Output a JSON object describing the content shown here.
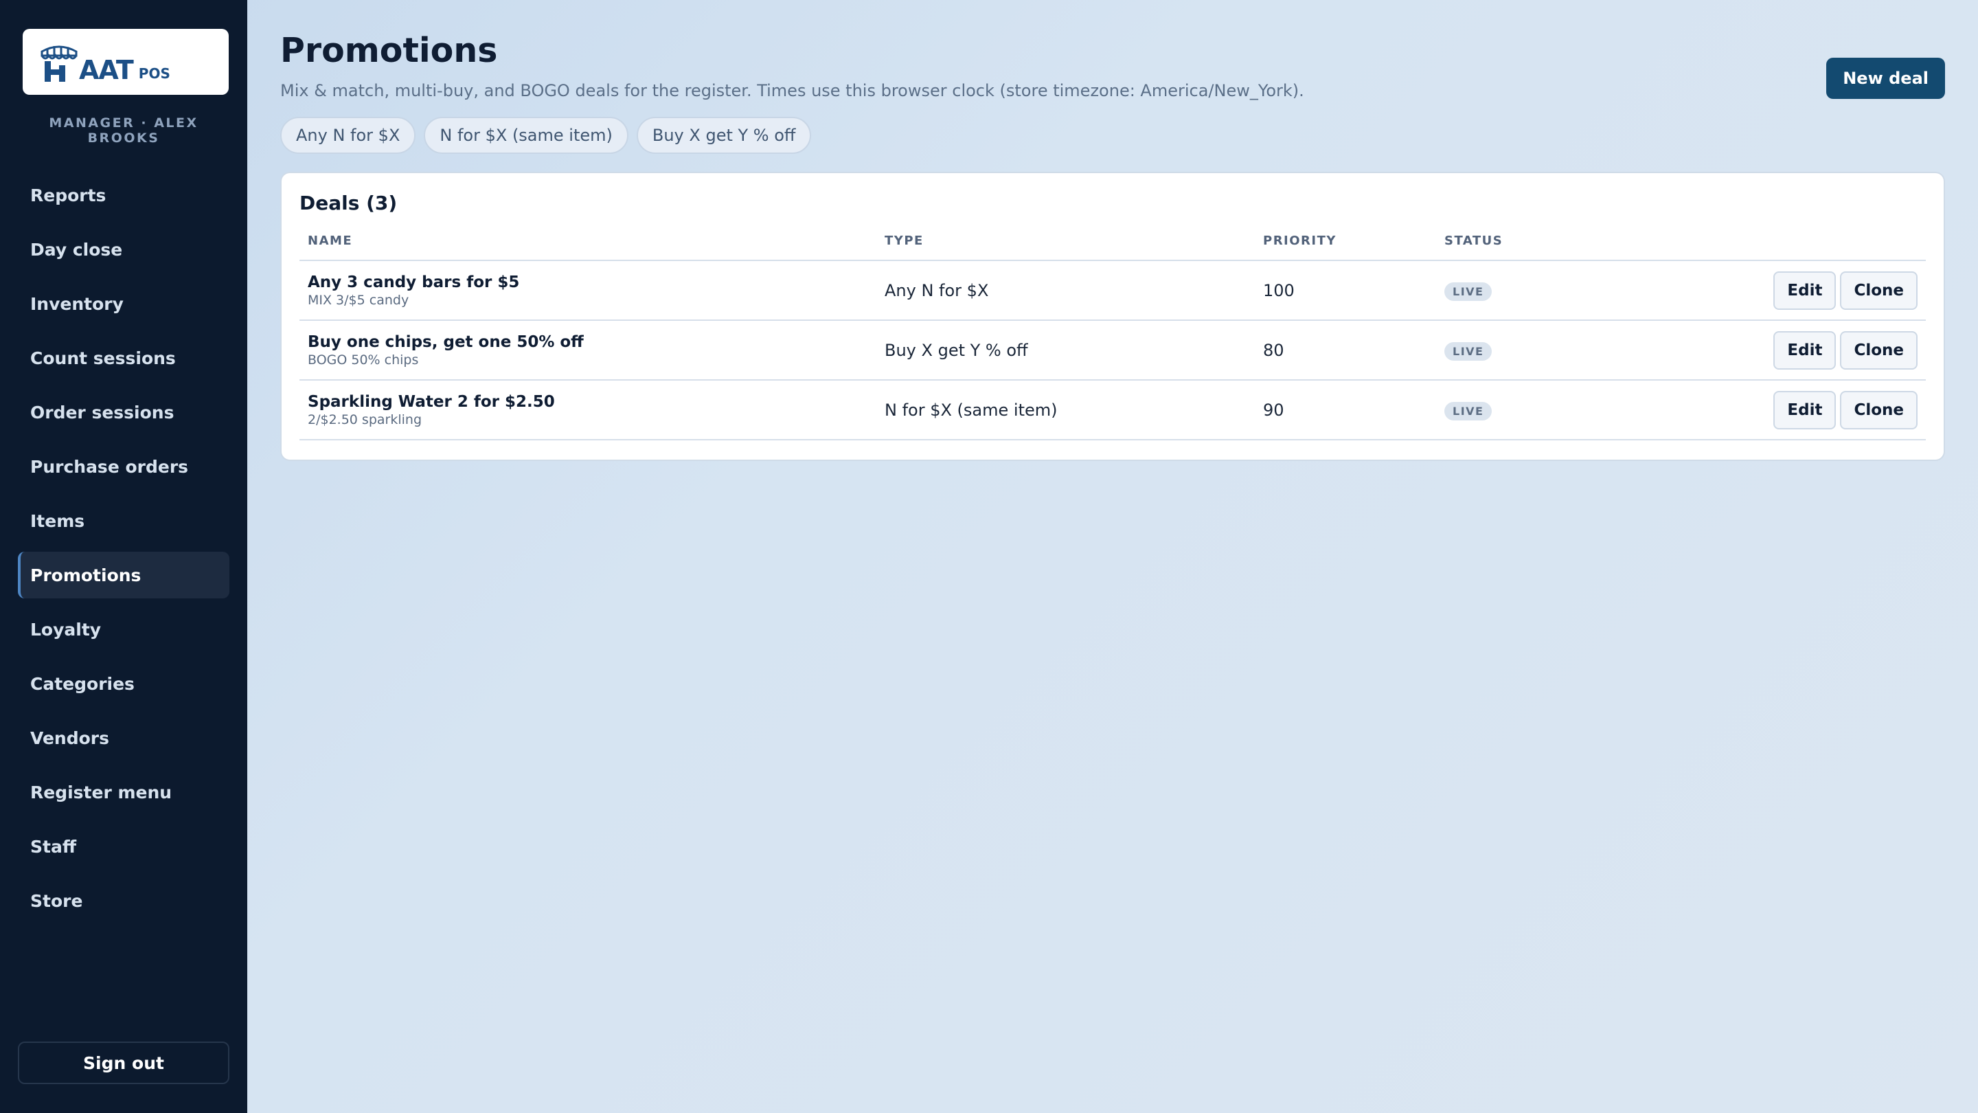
{
  "logo": {
    "text": "AAT",
    "sub": "POS"
  },
  "role_line": "MANAGER · ALEX BROOKS",
  "sidebar": {
    "items": [
      {
        "label": "Reports"
      },
      {
        "label": "Day close"
      },
      {
        "label": "Inventory"
      },
      {
        "label": "Count sessions"
      },
      {
        "label": "Order sessions"
      },
      {
        "label": "Purchase orders"
      },
      {
        "label": "Items"
      },
      {
        "label": "Promotions",
        "active": true
      },
      {
        "label": "Loyalty"
      },
      {
        "label": "Categories"
      },
      {
        "label": "Vendors"
      },
      {
        "label": "Register menu"
      },
      {
        "label": "Staff"
      },
      {
        "label": "Store"
      }
    ],
    "sign_out": "Sign out"
  },
  "header": {
    "title": "Promotions",
    "subtitle": "Mix & match, multi-buy, and BOGO deals for the register. Times use this browser clock (store timezone: America/New_York).",
    "new_deal": "New deal"
  },
  "chips": [
    "Any N for $X",
    "N for $X (same item)",
    "Buy X get Y % off"
  ],
  "deals": {
    "title": "Deals (3)",
    "columns": [
      "NAME",
      "TYPE",
      "PRIORITY",
      "STATUS"
    ],
    "rows": [
      {
        "name": "Any 3 candy bars for $5",
        "code": "MIX 3/$5 candy",
        "type": "Any N for $X",
        "priority": "100",
        "status": "LIVE",
        "edit": "Edit",
        "clone": "Clone"
      },
      {
        "name": "Buy one chips, get one 50% off",
        "code": "BOGO 50% chips",
        "type": "Buy X get Y % off",
        "priority": "80",
        "status": "LIVE",
        "edit": "Edit",
        "clone": "Clone"
      },
      {
        "name": "Sparkling Water 2 for $2.50",
        "code": "2/$2.50 sparkling",
        "type": "N for $X (same item)",
        "priority": "90",
        "status": "LIVE",
        "edit": "Edit",
        "clone": "Clone"
      }
    ]
  },
  "colors": {
    "sidebar_bg": "#0c1a2e",
    "accent": "#134a70",
    "logo_blue": "#1c4f86"
  }
}
